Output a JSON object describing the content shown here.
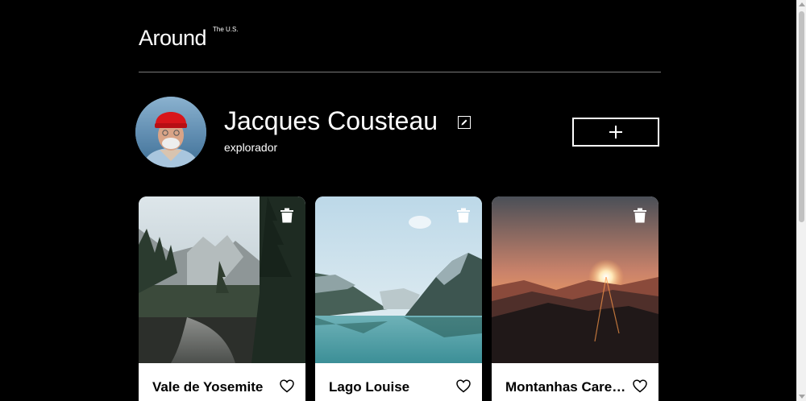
{
  "header": {
    "logo": "Around",
    "logo_sup": "The U.S."
  },
  "profile": {
    "name": "Jacques Cousteau",
    "about": "explorador",
    "edit_icon": "pencil-icon",
    "add_icon": "plus-icon"
  },
  "cards": [
    {
      "title": "Vale de Yosemite",
      "liked": false
    },
    {
      "title": "Lago Louise",
      "liked": false
    },
    {
      "title": "Montanhas Carecas",
      "liked": false
    }
  ],
  "colors": {
    "background": "#000000",
    "text": "#ffffff",
    "card_bg": "#ffffff",
    "card_text": "#000000",
    "divider": "#797979"
  }
}
